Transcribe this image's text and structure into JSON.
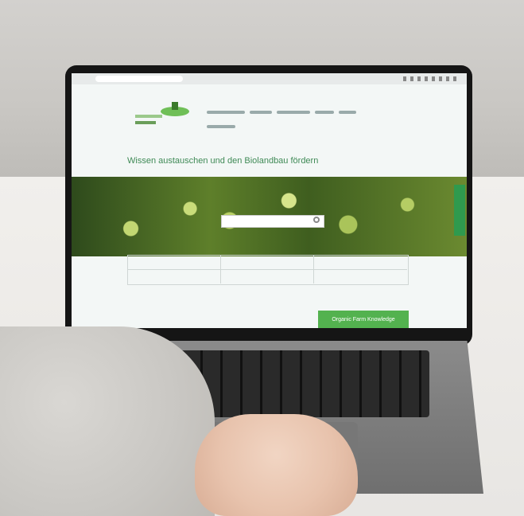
{
  "web_page": {
    "heading": "Wissen austauschen und den Biolandbau fördern",
    "cta_label": "Organic Farm Knowledge"
  }
}
